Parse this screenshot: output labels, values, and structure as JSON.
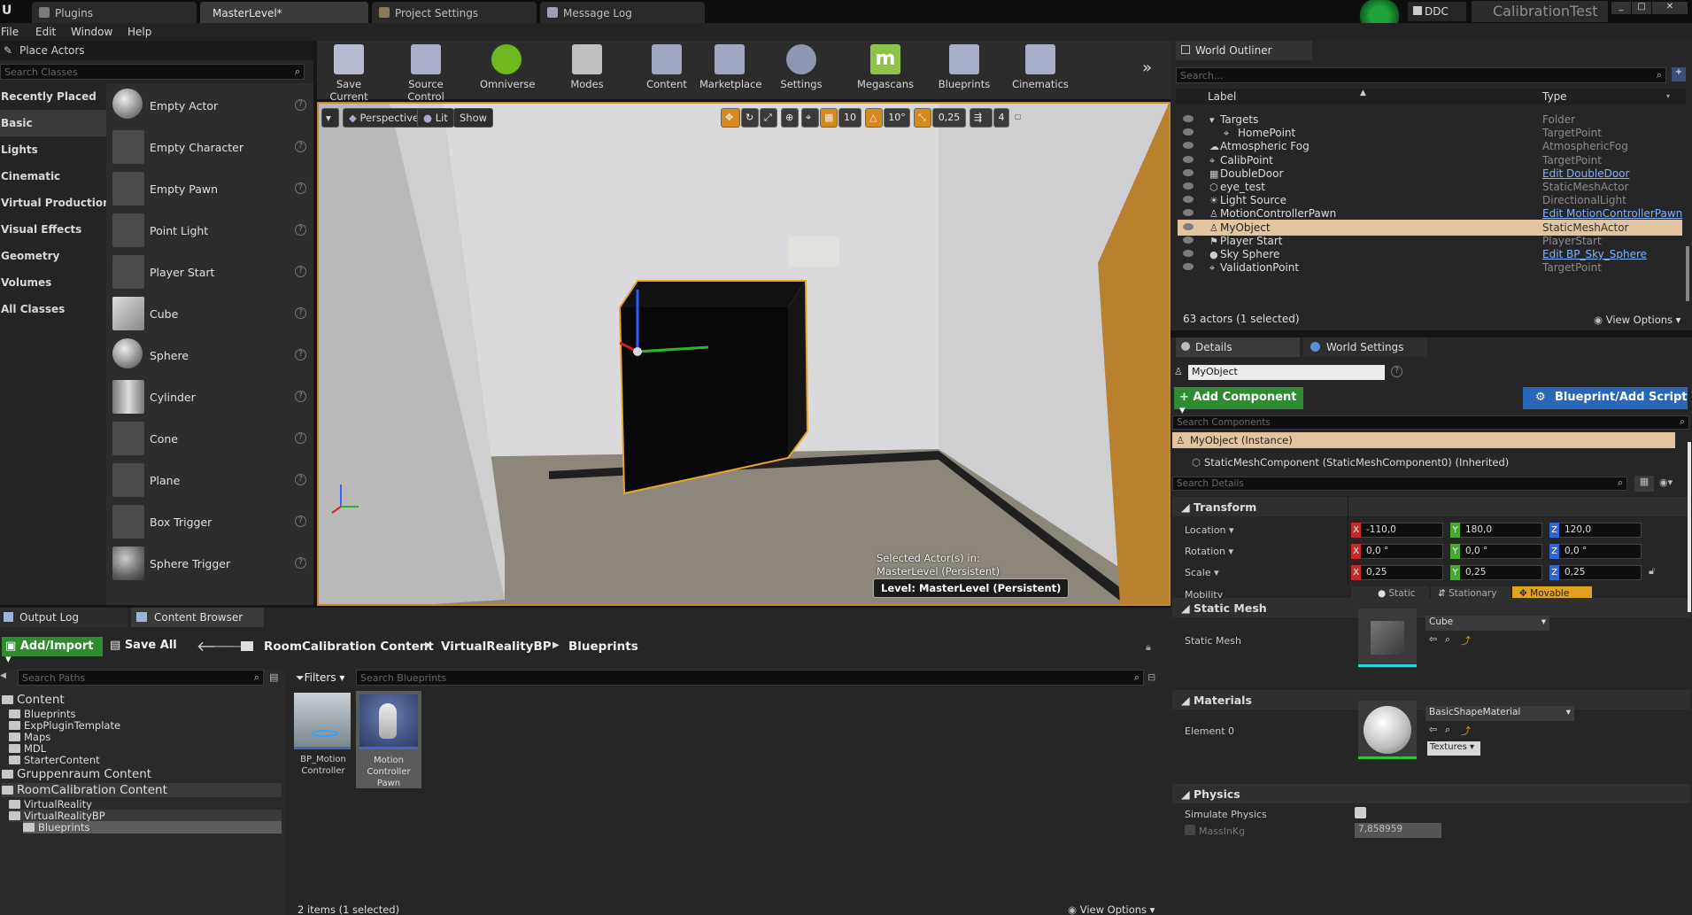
{
  "tabs": [
    {
      "label": "Plugins"
    },
    {
      "label": "MasterLevel*"
    },
    {
      "label": "Project Settings"
    },
    {
      "label": "Message Log"
    }
  ],
  "title_right": {
    "ddc": "DDC",
    "project": "CalibrationTest"
  },
  "menu": [
    "File",
    "Edit",
    "Window",
    "Help"
  ],
  "place_actors": {
    "title": "Place Actors",
    "search_placeholder": "Search Classes",
    "categories": [
      "Recently Placed",
      "Basic",
      "Lights",
      "Cinematic",
      "Virtual Production",
      "Visual Effects",
      "Geometry",
      "Volumes",
      "All Classes"
    ],
    "selected_category": "Basic",
    "items": [
      "Empty Actor",
      "Empty Character",
      "Empty Pawn",
      "Point Light",
      "Player Start",
      "Cube",
      "Sphere",
      "Cylinder",
      "Cone",
      "Plane",
      "Box Trigger",
      "Sphere Trigger"
    ]
  },
  "toolbar": [
    "Save Current",
    "Source Control",
    "Omniverse",
    "Modes",
    "Content",
    "Marketplace",
    "Settings",
    "Megascans",
    "Blueprints",
    "Cinematics"
  ],
  "viewport": {
    "perspective": "Perspective",
    "lit": "Lit",
    "show": "Show",
    "grid_snap": "10",
    "rot_snap": "10°",
    "scale_snap": "0,25",
    "cam_speed": "4",
    "selected_text_1": "Selected Actor(s) in:",
    "selected_text_2": "MasterLevel (Persistent)",
    "level_label": "Level:  MasterLevel (Persistent)",
    "colors": {
      "selection": "#e8a52a",
      "floor": "#8d877b",
      "wall": "#d8d8da"
    }
  },
  "outliner": {
    "title": "World Outliner",
    "search_placeholder": "Search...",
    "col_label": "Label",
    "col_type": "Type",
    "rows": [
      {
        "name": "Targets",
        "type": "Folder",
        "indent": 1,
        "link": false
      },
      {
        "name": "HomePoint",
        "type": "TargetPoint",
        "indent": 2,
        "link": false
      },
      {
        "name": "Atmospheric Fog",
        "type": "AtmosphericFog",
        "indent": 1,
        "link": false
      },
      {
        "name": "CalibPoint",
        "type": "TargetPoint",
        "indent": 1,
        "link": false
      },
      {
        "name": "DoubleDoor",
        "type": "Edit DoubleDoor",
        "indent": 1,
        "link": true
      },
      {
        "name": "eye_test",
        "type": "StaticMeshActor",
        "indent": 1,
        "link": false
      },
      {
        "name": "Light Source",
        "type": "DirectionalLight",
        "indent": 1,
        "link": false
      },
      {
        "name": "MotionControllerPawn",
        "type": "Edit MotionControllerPawn",
        "indent": 1,
        "link": true
      },
      {
        "name": "MyObject",
        "type": "StaticMeshActor",
        "indent": 1,
        "link": false,
        "selected": true
      },
      {
        "name": "Player Start",
        "type": "PlayerStart",
        "indent": 1,
        "link": false
      },
      {
        "name": "Sky Sphere",
        "type": "Edit BP_Sky_Sphere",
        "indent": 1,
        "link": true
      },
      {
        "name": "ValidationPoint",
        "type": "TargetPoint",
        "indent": 1,
        "link": false
      }
    ],
    "count": "63 actors (1 selected)",
    "view_options": "View Options"
  },
  "details": {
    "tab_details": "Details",
    "tab_world": "World Settings",
    "object_name": "MyObject",
    "add_component": "+ Add Component",
    "blueprint_script": "Blueprint/Add Script",
    "search_components": "Search Components",
    "instance": "MyObject (Instance)",
    "component": "StaticMeshComponent (StaticMeshComponent0) (Inherited)",
    "search_details": "Search Details",
    "transform": {
      "title": "Transform",
      "location_label": "Location",
      "rotation_label": "Rotation",
      "scale_label": "Scale",
      "mobility_label": "Mobility",
      "location": [
        "-110,0",
        "180,0",
        "120,0"
      ],
      "rotation": [
        "0,0 °",
        "0,0 °",
        "0,0 °"
      ],
      "scale": [
        "0,25",
        "0,25",
        "0,25"
      ],
      "mobility_options": [
        "Static",
        "Stationary",
        "Movable"
      ],
      "mobility_selected": "Movable"
    },
    "static_mesh": {
      "title": "Static Mesh",
      "label": "Static Mesh",
      "value": "Cube"
    },
    "materials": {
      "title": "Materials",
      "element_label": "Element 0",
      "value": "BasicShapeMaterial",
      "textures": "Textures"
    },
    "physics": {
      "title": "Physics",
      "simulate_label": "Simulate Physics",
      "mass_label": "MassInKg",
      "mass_value": "7,858959"
    }
  },
  "bottom_tabs": {
    "output_log": "Output Log",
    "content_browser": "Content Browser"
  },
  "content_browser": {
    "add_import": "Add/Import",
    "save_all": "Save All",
    "breadcrumb": [
      "RoomCalibration Content",
      "VirtualRealityBP",
      "Blueprints"
    ],
    "search_paths": "Search Paths",
    "filters": "Filters",
    "search_blueprints": "Search Blueprints",
    "tree": [
      {
        "label": "Content",
        "level": 0,
        "big": true
      },
      {
        "label": "Blueprints",
        "level": 1
      },
      {
        "label": "ExpPluginTemplate",
        "level": 1
      },
      {
        "label": "Maps",
        "level": 1
      },
      {
        "label": "MDL",
        "level": 1
      },
      {
        "label": "StarterContent",
        "level": 1
      },
      {
        "label": "Gruppenraum Content",
        "level": 0,
        "big": true
      },
      {
        "label": "RoomCalibration Content",
        "level": 0,
        "big": true,
        "highlight": true
      },
      {
        "label": "VirtualReality",
        "level": 1
      },
      {
        "label": "VirtualRealityBP",
        "level": 1,
        "highlight": true
      },
      {
        "label": "Blueprints",
        "level": 2,
        "selected": true
      }
    ],
    "assets": [
      {
        "name": "BP_Motion Controller"
      },
      {
        "name": "Motion Controller Pawn",
        "selected": true
      }
    ],
    "status": "2 items (1 selected)",
    "view_options": "View Options"
  }
}
